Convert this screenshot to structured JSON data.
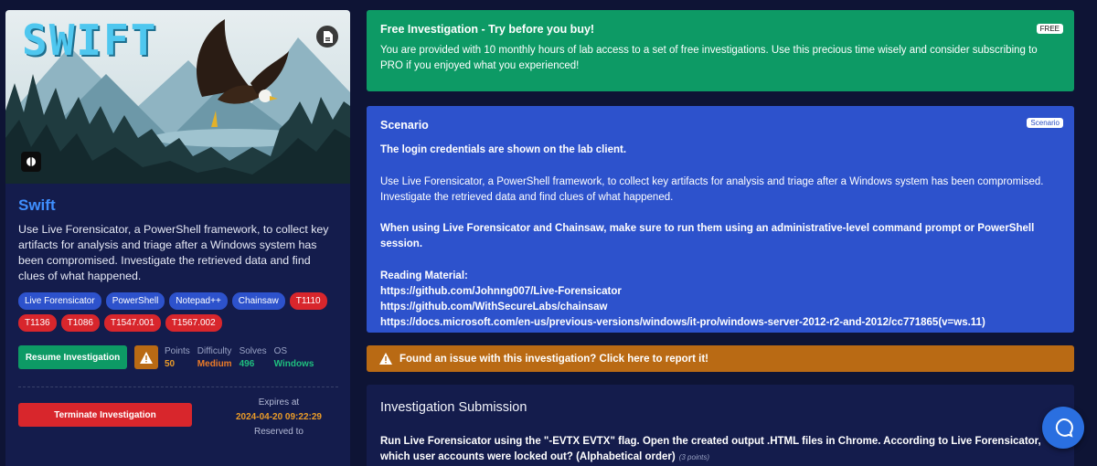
{
  "lab": {
    "hero_title": "SWIFT",
    "title": "Swift",
    "description": "Use Live Forensicator, a PowerShell framework, to collect key artifacts for analysis and triage after a Windows system has been compromised. Investigate the retrieved data and find clues of what happened.",
    "tags": [
      {
        "label": "Live Forensicator",
        "color": "blue"
      },
      {
        "label": "PowerShell",
        "color": "blue"
      },
      {
        "label": "Notepad++",
        "color": "blue"
      },
      {
        "label": "Chainsaw",
        "color": "blue"
      },
      {
        "label": "T1110",
        "color": "red"
      },
      {
        "label": "T1136",
        "color": "red"
      },
      {
        "label": "T1086",
        "color": "red"
      },
      {
        "label": "T1547.001",
        "color": "red"
      },
      {
        "label": "T1567.002",
        "color": "red"
      }
    ],
    "resume_label": "Resume Investigation",
    "stats": {
      "points_label": "Points",
      "points_value": "50",
      "difficulty_label": "Difficulty",
      "difficulty_value": "Medium",
      "solves_label": "Solves",
      "solves_value": "496",
      "os_label": "OS",
      "os_value": "Windows"
    },
    "terminate_label": "Terminate Investigation",
    "expires_label": "Expires at",
    "expires_value": "2024-04-20 09:22:29",
    "reserved_label": "Reserved to"
  },
  "free_panel": {
    "title": "Free Investigation - Try before you buy!",
    "badge": "FREE",
    "text": "You are provided with 10 monthly hours of lab access to a set of free investigations. Use this precious time wisely and consider subscribing to PRO if you enjoyed what you experienced!"
  },
  "scenario": {
    "title": "Scenario",
    "badge": "Scenario",
    "credentials": "The login credentials are shown on the lab client.",
    "body": "Use Live Forensicator, a PowerShell framework, to collect key artifacts for analysis and triage after a Windows system has been compromised. Investigate the retrieved data and find clues of what happened.",
    "admin_note": "When using Live Forensicator and Chainsaw, make sure to run them using an administrative-level command prompt or PowerShell session.",
    "reading_label": "Reading Material:",
    "links": [
      "https://github.com/Johnng007/Live-Forensicator",
      "https://github.com/WithSecureLabs/chainsaw",
      "https://docs.microsoft.com/en-us/previous-versions/windows/it-pro/windows-server-2012-r2-and-2012/cc771865(v=ws.11)"
    ]
  },
  "issue": {
    "text": "Found an issue with this investigation? Click here to report it!"
  },
  "submission": {
    "title": "Investigation Submission",
    "question": "Run Live Forensicator using the \"-EVTX EVTX\" flag. Open the created output .HTML files in Chrome. According to Live Forensicator, which user accounts were locked out? (Alphabetical order)",
    "points": "(3 points)"
  },
  "colors": {
    "background": "#0e1435",
    "card": "#141c4c",
    "green": "#0d9a65",
    "blue": "#2d52cc",
    "red": "#d8262c",
    "orange": "#b96a14",
    "accent_link": "#3f8fff"
  },
  "icons": [
    "pdf-icon",
    "windows-os-icon",
    "warning-icon",
    "chat-icon"
  ]
}
